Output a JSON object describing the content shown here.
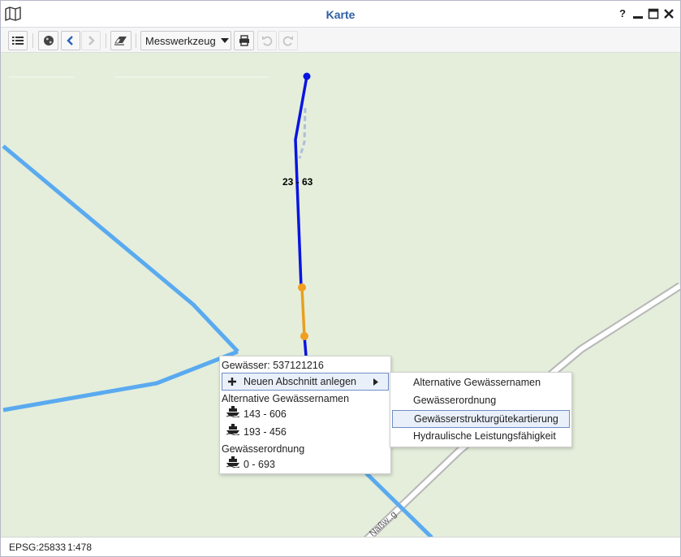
{
  "window": {
    "title": "Karte",
    "help_label": "?",
    "minimize_label": "▁",
    "maximize_label": "□",
    "close_label": "✕"
  },
  "toolbar": {
    "legend_icon": "list-icon",
    "globe_icon": "globe-icon",
    "back_icon": "chevron-left-icon",
    "forward_icon": "chevron-right-icon",
    "eraser_icon": "eraser-icon",
    "measure_tool_label": "Messwerkzeug",
    "print_icon": "print-icon",
    "undo_icon": "undo-icon",
    "redo_icon": "redo-icon"
  },
  "map": {
    "segment_label": "23 - 63",
    "street_label": "Naßw..g",
    "colors": {
      "background": "#e4eedb",
      "water_light": "#5aaaf0",
      "selected_water": "#0a14e0",
      "highlight_segment": "#e8a020",
      "road": "#c8c8c8"
    }
  },
  "context_menu": {
    "title": "Gewässer: 537121216",
    "new_section_label": "Neuen Abschnitt anlegen",
    "group_alt_names": "Alternative Gewässernamen",
    "alt_name_items": [
      "143 - 606",
      "193 - 456"
    ],
    "group_order": "Gewässerordnung",
    "order_items": [
      "0 - 693"
    ],
    "item_icon": "ship-icon"
  },
  "submenu": {
    "items": [
      "Alternative Gewässernamen",
      "Gewässerordnung",
      "Gewässerstrukturgütekartierung",
      "Hydraulische Leistungsfähigkeit"
    ],
    "active_index": 2
  },
  "status": {
    "projection": "EPSG:25833",
    "scale": "1:478"
  }
}
